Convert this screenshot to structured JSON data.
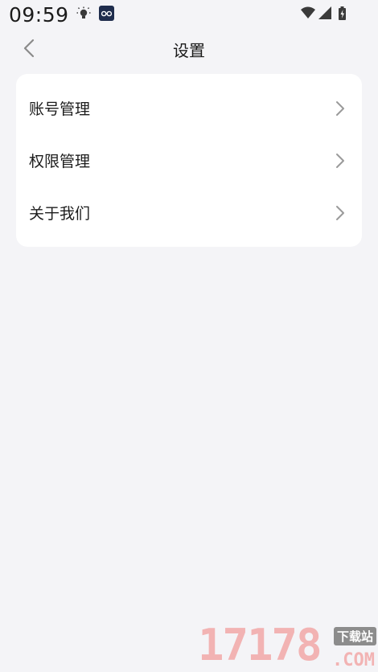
{
  "status_bar": {
    "time": "09:59",
    "icons": [
      "lightbulb-icon",
      "app-notification-icon",
      "wifi-icon",
      "signal-icon",
      "battery-charging-icon"
    ]
  },
  "header": {
    "title": "设置",
    "back_icon": "chevron-left-icon"
  },
  "settings": {
    "items": [
      {
        "label": "账号管理",
        "icon": "chevron-right-icon"
      },
      {
        "label": "权限管理",
        "icon": "chevron-right-icon"
      },
      {
        "label": "关于我们",
        "icon": "chevron-right-icon"
      }
    ]
  },
  "watermark": {
    "number": "17178",
    "badge": "下载站",
    "suffix": ".COM"
  },
  "colors": {
    "background": "#f4f4f7",
    "card": "#ffffff",
    "text": "#1c1c1c",
    "chevron": "#9a9a9a"
  }
}
